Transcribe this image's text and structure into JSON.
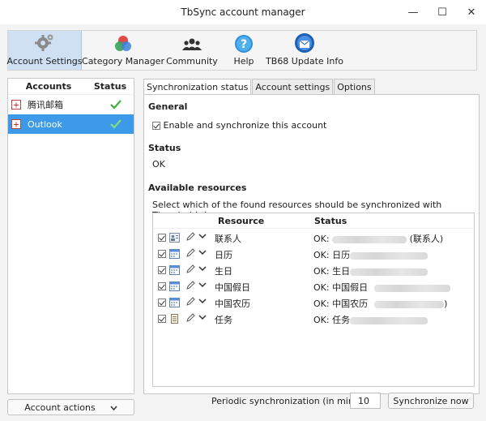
{
  "window": {
    "title": "TbSync account manager",
    "controls": [
      "—",
      "☐",
      "✕"
    ]
  },
  "toolbar": {
    "items": [
      {
        "label": "Account Settings",
        "icon": "gear-icon",
        "active": true
      },
      {
        "label": "Category Manager",
        "icon": "category-icon",
        "active": false
      },
      {
        "label": "Community",
        "icon": "people-icon",
        "active": false
      },
      {
        "label": "Help",
        "icon": "help-icon",
        "active": false
      },
      {
        "label": "TB68 Update Info",
        "icon": "thunderbird-icon",
        "active": false
      }
    ]
  },
  "accounts": {
    "headers": {
      "accounts": "Accounts",
      "status": "Status"
    },
    "items": [
      {
        "name": "腾讯邮箱",
        "status": "ok"
      },
      {
        "name": "Outlook",
        "status": "ok"
      }
    ],
    "actions_label": "Account actions"
  },
  "tabs": [
    "Synchronization status",
    "Account settings",
    "Options"
  ],
  "general": {
    "title": "General",
    "enable_label": "Enable and synchronize this account"
  },
  "status": {
    "title": "Status",
    "value": "OK"
  },
  "resources": {
    "title": "Available resources",
    "description": "Select which of the found resources should be synchronized with Thunderbird.",
    "headers": {
      "resource": "Resource",
      "status": "Status"
    },
    "rows": [
      {
        "name": "联系人",
        "status_prefix": "OK: ",
        "status_suffix": " (联系人)",
        "kind": "addressbook"
      },
      {
        "name": "日历",
        "status_prefix": "OK: 日历",
        "status_suffix": "",
        "kind": "calendar"
      },
      {
        "name": "生日",
        "status_prefix": "OK: 生日",
        "status_suffix": "",
        "kind": "calendar"
      },
      {
        "name": "中国假日",
        "status_prefix": "OK: 中国假日",
        "status_suffix": "",
        "kind": "calendar"
      },
      {
        "name": "中国农历",
        "status_prefix": "OK: 中国农历",
        "status_suffix": ")",
        "kind": "calendar"
      },
      {
        "name": "任务",
        "status_prefix": "OK: 任务",
        "status_suffix": "",
        "kind": "task"
      }
    ]
  },
  "footer": {
    "periodic_label": "Periodic synchronization (in minutes)",
    "interval": "10",
    "sync_now": "Synchronize now"
  },
  "colors": {
    "selection": "#3d9ae8",
    "check": "#3cae3c"
  }
}
